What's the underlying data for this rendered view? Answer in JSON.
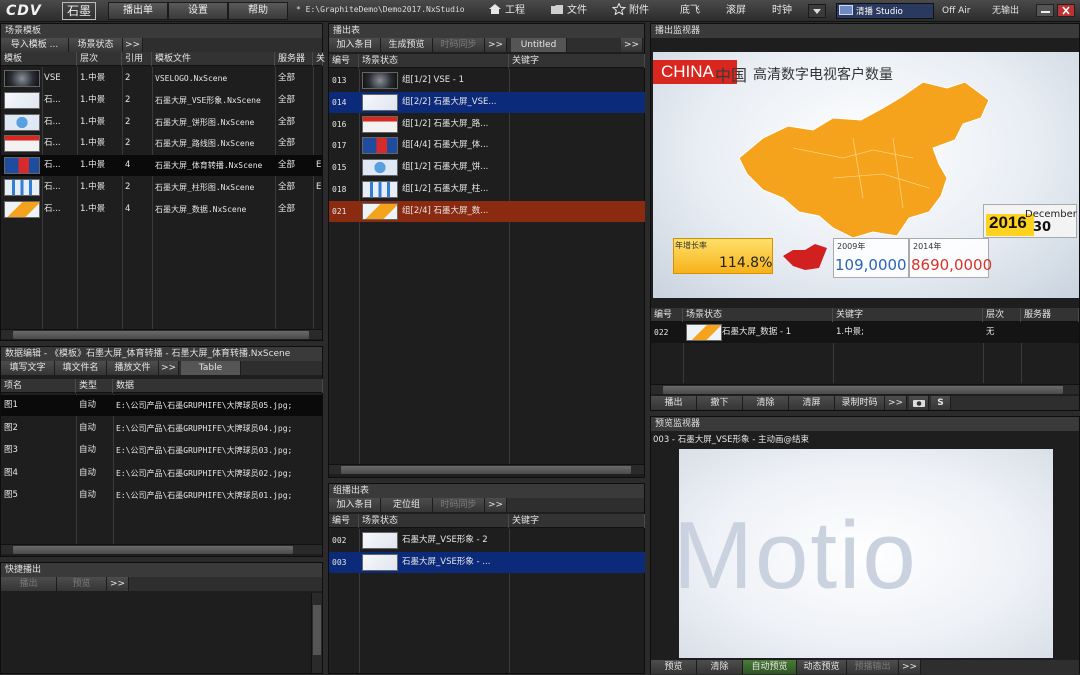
{
  "app": {
    "logo": "CDV",
    "logo_sub": "石墨",
    "path": "* E:\\GraphiteDemo\\Demo2017.NxStudio"
  },
  "menu": [
    {
      "label": "播出单"
    },
    {
      "label": "设置"
    },
    {
      "label": "帮助"
    }
  ],
  "toolbar": {
    "project": "工程",
    "file": "文件",
    "attach": "附件",
    "dijia": "底飞",
    "guanping": "滚屏",
    "clock": "时钟",
    "preview_mode": "清播 Studio",
    "off_air": "Off Air",
    "no_output": "无输出"
  },
  "scene_template": {
    "title": "场景模板",
    "buttons": [
      {
        "label": "导入模板 ..."
      },
      {
        "label": "场景状态"
      },
      {
        "label": ">>"
      }
    ],
    "columns": [
      "模板",
      "层次",
      "引用",
      "模板文件",
      "服务器",
      "关"
    ],
    "rows": [
      {
        "name": "VSE",
        "layer": "1.中景",
        "ref": "2",
        "file": "VSELOGO.NxScene",
        "server": "全部",
        "extra": "",
        "thumb": "dark"
      },
      {
        "name": "石...",
        "layer": "1.中景",
        "ref": "2",
        "file": "石墨大屏_VSE形象.NxScene",
        "server": "全部",
        "extra": "",
        "thumb": "white"
      },
      {
        "name": "石...",
        "layer": "1.中景",
        "ref": "2",
        "file": "石墨大屏_饼形图.NxScene",
        "server": "全部",
        "extra": "",
        "thumb": "pie"
      },
      {
        "name": "石...",
        "layer": "1.中景",
        "ref": "2",
        "file": "石墨大屏_路线图.NxScene",
        "server": "全部",
        "extra": "",
        "thumb": "route"
      },
      {
        "name": "石...",
        "layer": "1.中景",
        "ref": "4",
        "file": "石墨大屏_体育转播.NxScene",
        "server": "全部",
        "extra": "E",
        "thumb": "sport"
      },
      {
        "name": "石...",
        "layer": "1.中景",
        "ref": "2",
        "file": "石墨大屏_柱形图.NxScene",
        "server": "全部",
        "extra": "E",
        "thumb": "bar"
      },
      {
        "name": "石...",
        "layer": "1.中景",
        "ref": "4",
        "file": "石墨大屏_数据.NxScene",
        "server": "全部",
        "extra": "",
        "thumb": "map"
      }
    ],
    "selected_row": 4
  },
  "data_edit": {
    "title": "数据编辑 - 《模板》石墨大屏_体育转播 - 石墨大屏_体育转播.NxScene",
    "buttons": [
      {
        "label": "填写文字"
      },
      {
        "label": "填文件名"
      },
      {
        "label": "播放文件"
      },
      {
        "label": ">>"
      }
    ],
    "tab": "Table",
    "columns": [
      "项名",
      "类型",
      "数据"
    ],
    "rows": [
      {
        "item": "图1",
        "type": "自动",
        "data": "E:\\公司产品\\石墨GRUPHIFE\\大牌球员05.jpg;"
      },
      {
        "item": "图2",
        "type": "自动",
        "data": "E:\\公司产品\\石墨GRUPHIFE\\大牌球员04.jpg;"
      },
      {
        "item": "图3",
        "type": "自动",
        "data": "E:\\公司产品\\石墨GRUPHIFE\\大牌球员03.jpg;"
      },
      {
        "item": "图4",
        "type": "自动",
        "data": "E:\\公司产品\\石墨GRUPHIFE\\大牌球员02.jpg;"
      },
      {
        "item": "图5",
        "type": "自动",
        "data": "E:\\公司产品\\石墨GRUPHIFE\\大牌球员01.jpg;"
      }
    ]
  },
  "quick_play": {
    "title": "快捷播出",
    "buttons": [
      {
        "label": "播出"
      },
      {
        "label": "预览"
      },
      {
        "label": ">>"
      }
    ]
  },
  "playlist": {
    "title": "播出表",
    "buttons": [
      {
        "label": "加入条目"
      },
      {
        "label": "生成预览"
      },
      {
        "label": "时码同步"
      },
      {
        "label": ">>"
      }
    ],
    "tab": "Untitled",
    "columns": [
      "编号",
      "场景状态",
      "关键字"
    ],
    "rows": [
      {
        "id": "013",
        "status": "组[1/2] VSE - 1",
        "thumb": "dark",
        "state": "normal"
      },
      {
        "id": "014",
        "status": "组[2/2] 石墨大屏_VSE...",
        "thumb": "white",
        "state": "blue"
      },
      {
        "id": "016",
        "status": "组[1/2] 石墨大屏_路...",
        "thumb": "route",
        "state": "normal"
      },
      {
        "id": "017",
        "status": "组[4/4] 石墨大屏_体...",
        "thumb": "sport",
        "state": "normal"
      },
      {
        "id": "015",
        "status": "组[1/2] 石墨大屏_饼...",
        "thumb": "pie",
        "state": "normal"
      },
      {
        "id": "018",
        "status": "组[1/2] 石墨大屏_柱...",
        "thumb": "bar",
        "state": "normal"
      },
      {
        "id": "021",
        "status": "组[2/4] 石墨大屏_数...",
        "thumb": "map",
        "state": "red"
      }
    ]
  },
  "group_play": {
    "title": "组播出表",
    "buttons": [
      {
        "label": "加入条目"
      },
      {
        "label": "定位组"
      },
      {
        "label": "时码同步"
      },
      {
        "label": ">>"
      }
    ],
    "columns": [
      "编号",
      "场景状态",
      "关键字"
    ],
    "rows": [
      {
        "id": "002",
        "status": "石墨大屏_VSE形象 - 2",
        "thumb": "white",
        "state": "normal"
      },
      {
        "id": "003",
        "status": "石墨大屏_VSE形象 - ...",
        "thumb": "white",
        "state": "blue"
      }
    ]
  },
  "program_monitor": {
    "title": "播出监视器",
    "screen": {
      "china_en": "CHINA",
      "china_cn": "中国",
      "headline": "高清数字电视客户数量",
      "year": "2016",
      "month": "December",
      "day": "30",
      "growth_label": "年增长率",
      "growth_value": "114.8%",
      "y2009_label": "2009年",
      "y2009_value": "109,0000",
      "y2014_label": "2014年",
      "y2014_value": "8690,0000"
    },
    "columns": [
      "编号",
      "场景状态",
      "关键字",
      "层次",
      "服务器"
    ],
    "row": {
      "id": "022",
      "status": "石墨大屏_数据 - 1",
      "keyword": "1.中景;",
      "layer": "无",
      "server": ""
    },
    "buttons": [
      {
        "label": "播出"
      },
      {
        "label": "撤下"
      },
      {
        "label": "清除"
      },
      {
        "label": "清屏"
      },
      {
        "label": "录制时码"
      },
      {
        "label": ">>"
      },
      {
        "label": "S"
      }
    ]
  },
  "preview_monitor": {
    "title": "预览监视器",
    "subtitle": "003 - 石墨大屏_VSE形象 - 主动画@结束",
    "screen_text": "Motio",
    "buttons": [
      {
        "label": "预览"
      },
      {
        "label": "清除"
      },
      {
        "label": "自动预览"
      },
      {
        "label": "动态预览"
      },
      {
        "label": "预播输出"
      },
      {
        "label": ">>"
      }
    ]
  }
}
